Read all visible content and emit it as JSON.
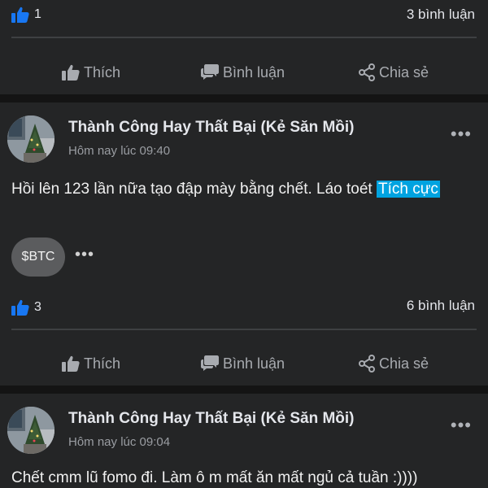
{
  "colors": {
    "background": "#141414",
    "card": "#242526",
    "accent_blue": "#1877f2",
    "highlight": "#00a3e0"
  },
  "actions": {
    "like": "Thích",
    "comment": "Bình luận",
    "share": "Chia sẻ"
  },
  "icons": {
    "like": "thumbs-up-icon",
    "comment": "comment-icon",
    "share": "share-icon",
    "more": "more-icon"
  },
  "top_stats": {
    "likes": "1",
    "comments": "3 bình luận"
  },
  "posts": [
    {
      "author": "Thành Công Hay Thất Bại (Kẻ Săn Mồi)",
      "time": "Hôm nay lúc 09:40",
      "text": "Hồi lên 123 lần nữa tạo đập mày bằng chết. Láo toét ",
      "highlight": "Tích cực",
      "ticker": "$BTC",
      "ticker_more": "•••",
      "likes": "3",
      "comments": "6 bình luận"
    },
    {
      "author": "Thành Công Hay Thất Bại (Kẻ Săn Mồi)",
      "time": "Hôm nay lúc 09:04",
      "text": "Chết cmm lũ fomo đi. Làm ô m mất ăn mất ngủ cả tuần :))))"
    }
  ],
  "more_label": "•••"
}
